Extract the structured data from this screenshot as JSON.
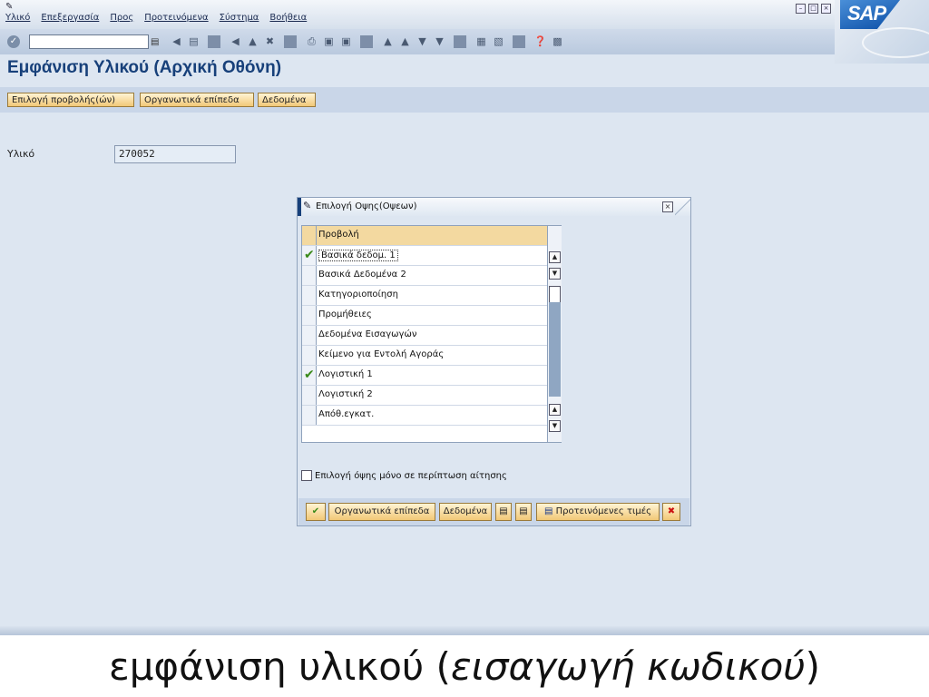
{
  "menu": [
    "Υλικό",
    "Επεξεργασία",
    "Προς",
    "Προτεινόμενα",
    "Σύστημα",
    "Βοήθεια"
  ],
  "logo_text": "SAP",
  "page_title": "Εμφάνιση Υλικού (Αρχική Οθόνη)",
  "app_toolbar": {
    "select_views": "Επιλογή προβολής(ών)",
    "org_levels": "Οργανωτικά επίπεδα",
    "data": "Δεδομένα"
  },
  "material_field": {
    "label": "Υλικό",
    "value": "270052"
  },
  "dialog": {
    "title": "Επιλογή Οψης(Οψεων)",
    "column_header": "Προβολή",
    "views": [
      {
        "label": "Βασικά δεδομ. 1",
        "checked": true,
        "focused": true
      },
      {
        "label": "Βασικά Δεδομένα 2",
        "checked": false
      },
      {
        "label": "Κατηγοριοποίηση",
        "checked": false
      },
      {
        "label": "Προμήθειες",
        "checked": false
      },
      {
        "label": "Δεδομένα Εισαγωγών",
        "checked": false
      },
      {
        "label": "Κείμενο για Εντολή Αγοράς",
        "checked": false
      },
      {
        "label": "Λογιστική 1",
        "checked": true
      },
      {
        "label": "Λογιστική 2",
        "checked": false
      },
      {
        "label": "Απόθ.εγκατ.",
        "checked": false
      }
    ],
    "option_label": "Επιλογή όψης μόνο σε περίπτωση αίτησης",
    "buttons": {
      "org_levels": "Οργανωτικά επίπεδα",
      "data": "Δεδομένα",
      "defaults": "Προτεινόμενες τιμές"
    }
  },
  "caption": {
    "main": "εμφάνιση υλικού (",
    "italic": "εισαγωγή κωδικού",
    "end": ")"
  },
  "colors": {
    "title": "#17407a",
    "button": "#f2c877",
    "background": "#dde6f1",
    "header_row": "#f3d9a0",
    "check": "#3a8a1a",
    "cancel": "#cc1111"
  }
}
